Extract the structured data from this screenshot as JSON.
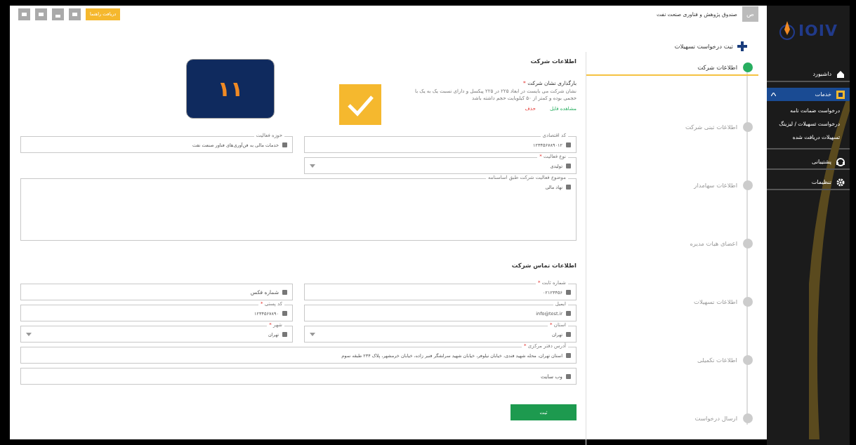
{
  "topbar": {
    "avatar": "ص",
    "title": "صندوق پژوهش و فناوری صنعت نفت",
    "help_button": "دریافت راهنما"
  },
  "sidebar": {
    "logo": "IOIV",
    "items": [
      {
        "label": "داشبورد",
        "selected": false
      },
      {
        "label": "خدمات",
        "selected": true,
        "expanded": true,
        "children": [
          {
            "label": "درخواست ضمانت نامه"
          },
          {
            "label": "درخواست تسهیلات / لیزینگ"
          },
          {
            "label": "تسهیلات دریافت شده"
          }
        ]
      },
      {
        "label": "پشتیبانی",
        "selected": false
      },
      {
        "label": "تنظیمات",
        "selected": false
      }
    ]
  },
  "page_title": "ثبت درخواست تسهیلات",
  "steps": [
    {
      "label": "اطلاعات شرکت",
      "selected": true
    },
    {
      "label": "اطلاعات ثبتی شرکت",
      "selected": false
    },
    {
      "label": "اطلاعات سهامدار",
      "selected": false
    },
    {
      "label": "اعضای هیات مدیره",
      "selected": false
    },
    {
      "label": "اطلاعات تسهیلات",
      "selected": false
    },
    {
      "label": "اطلاعات تکمیلی",
      "selected": false
    },
    {
      "label": "ارسال درخواست",
      "selected": false
    }
  ],
  "form": {
    "title": "اطلاعات شرکت",
    "logo_upload": {
      "label": "بارگذاری نشان شرکت",
      "mark": "*",
      "hint": "نشان شرکت می بایست در ابعاد ۲۲۵ در ۲۲۵ پیکسل و دارای نسبت یک به یک با حجمی بوده و کمتر از ۵۰ کیلوبایت حجم داشته باشد",
      "actions": [
        {
          "label": "مشاهده فایل",
          "kind": "view"
        },
        {
          "label": "حذف",
          "kind": "delete"
        }
      ],
      "preview": "۱۱"
    },
    "rows": [
      [
        {
          "label": "کد اقتصادی",
          "kind": "text",
          "value": "۱۲۳۴۵۶۷۸۹۰۱۲"
        },
        {
          "label": "حوزه فعالیت",
          "kind": "text",
          "value": "خدمات مالی به فن‌آوری‌های فناور صنعت نفت"
        }
      ],
      [
        {
          "label": "نوع فعالیت",
          "mark": "*",
          "kind": "select",
          "value": "تولیدی"
        }
      ],
      [
        {
          "label": "موضوع فعالیت شرکت طبق اساسنامه",
          "kind": "textarea",
          "value": "نهاد مالی"
        }
      ]
    ],
    "contact_title": "اطلاعات تماس شرکت",
    "contact_rows": [
      [
        {
          "label": "شماره ثابت",
          "mark": "*",
          "kind": "text",
          "value": "۰۲۱۲۳۴۵۶"
        },
        {
          "kind": "text",
          "placeholder": "شماره فکس"
        }
      ],
      [
        {
          "label": "ایمیل",
          "kind": "text",
          "value": "info@test.ir"
        },
        {
          "label": "کد پستی",
          "mark": "*",
          "kind": "text",
          "value": "۱۲۳۴۵۶۷۸۹۰"
        }
      ],
      [
        {
          "label": "استان",
          "mark": "*",
          "kind": "select",
          "value": "تهران"
        },
        {
          "label": "شهر",
          "mark": "*",
          "kind": "select",
          "value": "تهران"
        }
      ],
      [
        {
          "label": "آدرس دفتر مرکزی",
          "mark": "*",
          "kind": "text",
          "value": "استان تهران، محله شهید قندی، خیابان نیلوفر، خیابان شهید سرلشگر قنبر زاده، خیابان خرمشهر، پلاک ۲۳۴ طبقه سوم"
        }
      ],
      [
        {
          "kind": "text",
          "placeholder": "وب سایت"
        }
      ]
    ],
    "submit": "ثبت"
  }
}
